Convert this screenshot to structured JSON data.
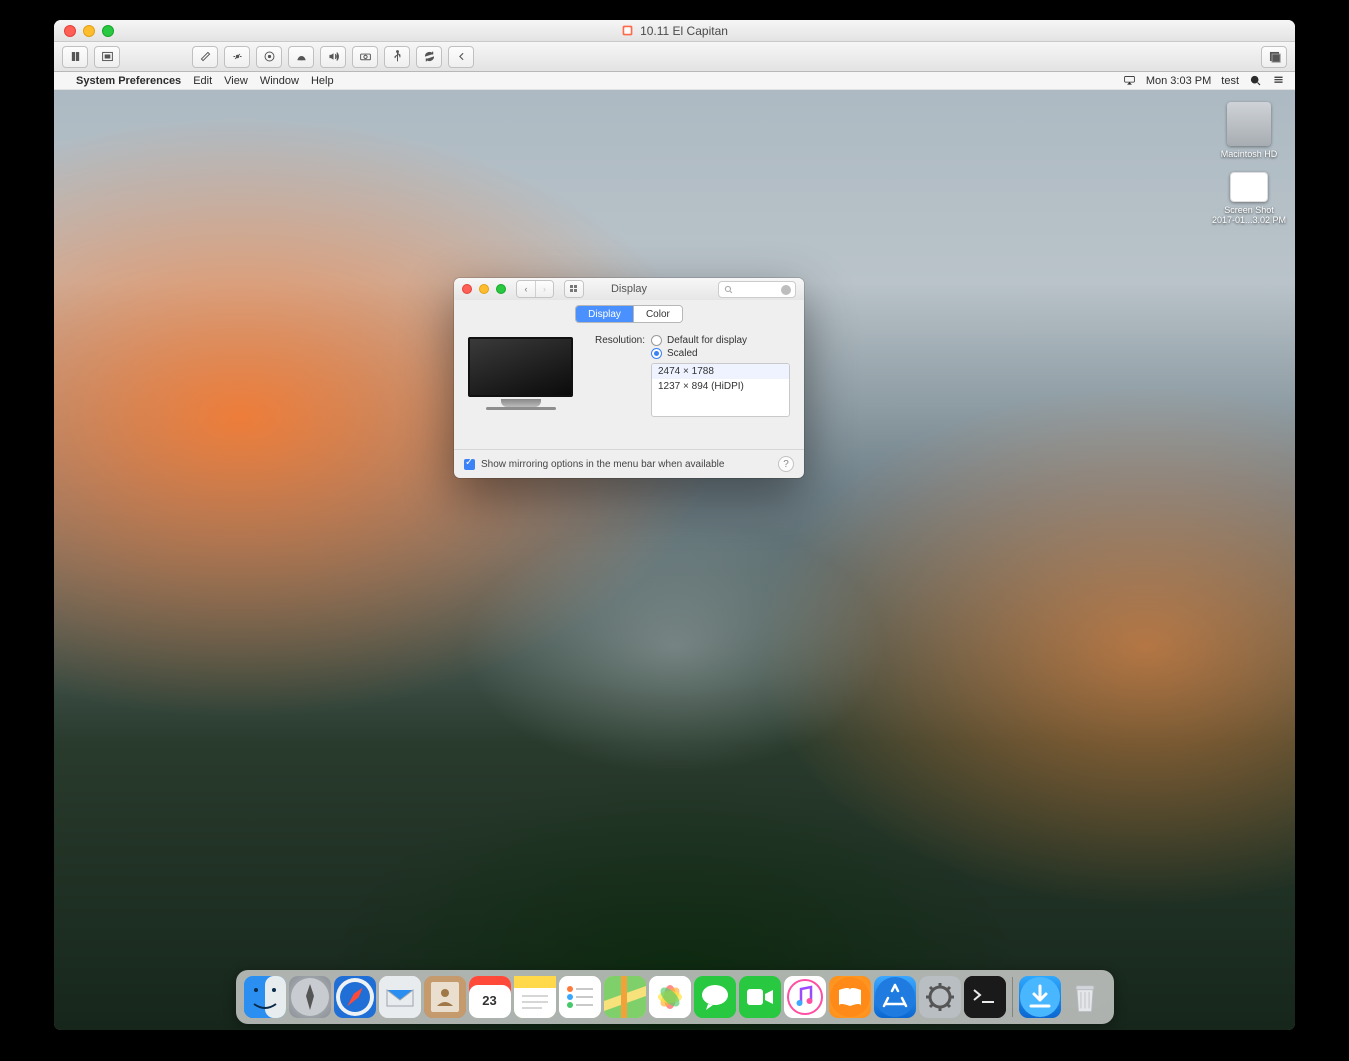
{
  "vmware": {
    "title": "10.11 El Capitan",
    "toolbar": {
      "pause": "pause-icon",
      "snapshot": "snapshot-icon",
      "settings": "wrench-icon",
      "network": "network-icon",
      "harddisk": "harddisk-icon",
      "cdrom": "cdrom-icon",
      "sound": "sound-icon",
      "camera": "camera-icon",
      "usb": "usb-icon",
      "sync": "sync-icon",
      "left": "chevron-left-icon",
      "fullscreen": "fullscreen-icon"
    }
  },
  "menubar": {
    "app": "System Preferences",
    "items": [
      "Edit",
      "View",
      "Window",
      "Help"
    ],
    "clock": "Mon 3:03 PM",
    "user": "test"
  },
  "desktop": {
    "hd_label": "Macintosh HD",
    "screenshot_label1": "Screen Shot",
    "screenshot_label2": "2017-01...3.02 PM"
  },
  "prefs": {
    "title": "Display",
    "search_placeholder": "",
    "tabs": {
      "display": "Display",
      "color": "Color"
    },
    "resolution_label": "Resolution:",
    "default_label": "Default for display",
    "scaled_label": "Scaled",
    "resolutions": [
      "2474 × 1788",
      "1237 × 894 (HiDPI)"
    ],
    "mirroring_label": "Show mirroring options in the menu bar when available"
  },
  "dock": {
    "apps": [
      "Finder",
      "Launchpad",
      "Safari",
      "Mail",
      "Contacts",
      "Calendar",
      "Notes",
      "Reminders",
      "Maps",
      "Photos",
      "Messages",
      "FaceTime",
      "iTunes",
      "iBooks",
      "App Store",
      "System Preferences",
      "Terminal"
    ],
    "cal_day": "23",
    "trash": "Trash",
    "downloads": "Downloads"
  }
}
